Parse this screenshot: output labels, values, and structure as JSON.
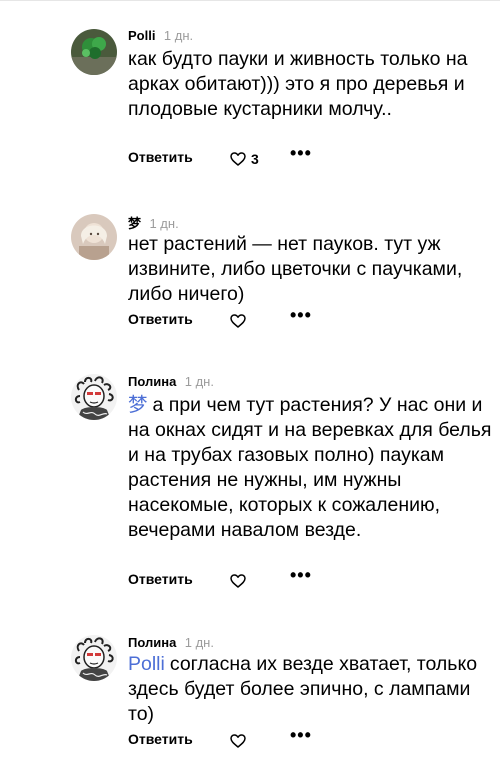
{
  "comments": [
    {
      "author": "Polli",
      "age": "1 дн.",
      "mention": "",
      "text": "как будто пауки и живность только на арках обитают))) это я про деревья и плодовые кустарники молчу..",
      "reply_label": "Ответить",
      "likes": "3",
      "more": "•••",
      "avatar_icon": "green-plant-avatar"
    },
    {
      "author": "梦",
      "age": "1 дн.",
      "mention": "",
      "text": "нет растений — нет пауков. тут уж извините, либо цветочки с паучками, либо ничего)",
      "reply_label": "Ответить",
      "likes": "",
      "more": "•••",
      "avatar_icon": "person-photo-avatar"
    },
    {
      "author": "Полина",
      "age": "1 дн.",
      "mention": "梦",
      "text": "а при чем тут растения? У нас они и на окнах сидят и на веревках для белья и на трубах газовых полно) паукам растения не нужны, им нужны насекомые, которых к сожалению, вечерами навалом везде.",
      "reply_label": "Ответить",
      "likes": "",
      "more": "•••",
      "avatar_icon": "medusa-drawing-avatar"
    },
    {
      "author": "Полина",
      "age": "1 дн.",
      "mention": "Polli",
      "text": "согласна их везде хватает, только здесь будет более эпично, с лампами то)",
      "reply_label": "Ответить",
      "likes": "",
      "more": "•••",
      "avatar_icon": "medusa-drawing-avatar"
    }
  ],
  "colors": {
    "mention": "#4d6fd6",
    "age": "#9c9c9c",
    "text": "#000000"
  }
}
